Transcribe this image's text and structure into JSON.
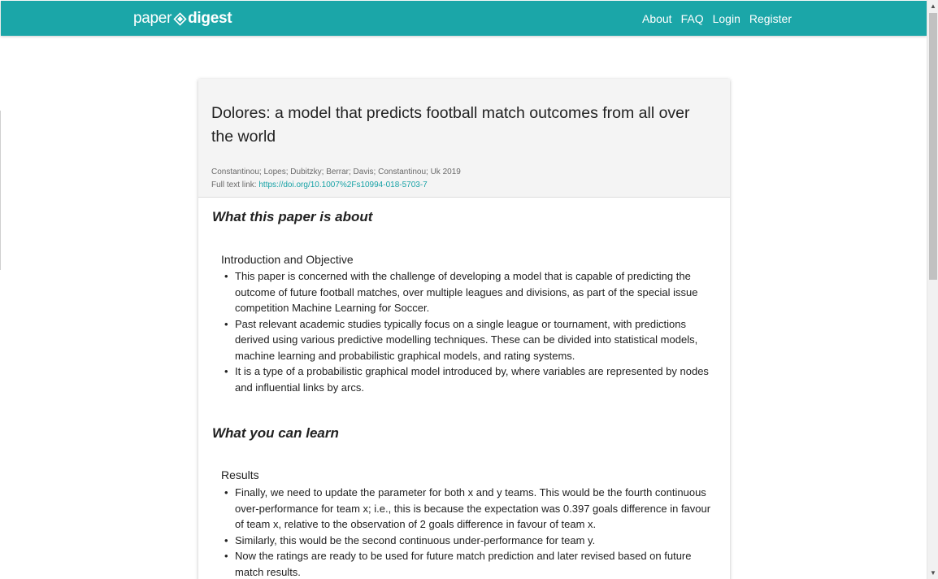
{
  "header": {
    "brand_light": "paper",
    "brand_bold": "digest",
    "nav": [
      "About",
      "FAQ",
      "Login",
      "Register"
    ]
  },
  "paper": {
    "title": "Dolores: a model that predicts football match outcomes from all over the world",
    "authors_year": "Constantinou; Lopes; Dubitzky; Berrar; Davis; Constantinou; Uk 2019",
    "fulltext_label": "Full text link:",
    "fulltext_url": "https://doi.org/10.1007%2Fs10994-018-5703-7"
  },
  "sections": [
    {
      "heading": "What this paper is about",
      "subheading": "Introduction and Objective",
      "bullets": [
        "This paper is concerned with the challenge of developing a model that is capable of predicting the outcome of future football matches, over multiple leagues and divisions, as part of the special issue competition Machine Learning for Soccer.",
        "Past relevant academic studies typically focus on a single league or tournament, with predictions derived using various predictive modelling techniques. These can be divided into statistical models, machine learning and probabilistic graphical models, and rating systems.",
        "It is a type of a probabilistic graphical model introduced by, where variables are represented by nodes and influential links by arcs."
      ]
    },
    {
      "heading": "What you can learn",
      "subheading": "Results",
      "bullets": [
        "Finally, we need to update the parameter for both x and y teams. This would be the fourth continuous over-performance for team x; i.e., this is because the expectation was 0.397 goals difference in favour of team x, relative to the observation of 2 goals difference in favour of team x.",
        "Similarly, this would be the second continuous under-performance for team y.",
        "Now the ratings are ready to be used for future match prediction and later revised based on future match results."
      ]
    }
  ],
  "colors": {
    "brand": "#1ba6a8",
    "link": "#17a2a6",
    "header_bg": "#f4f4f4"
  },
  "icons": {
    "brand_mark": "diamond-logo-icon",
    "scroll_up": "chevron-up-icon",
    "scroll_down": "chevron-down-icon"
  }
}
